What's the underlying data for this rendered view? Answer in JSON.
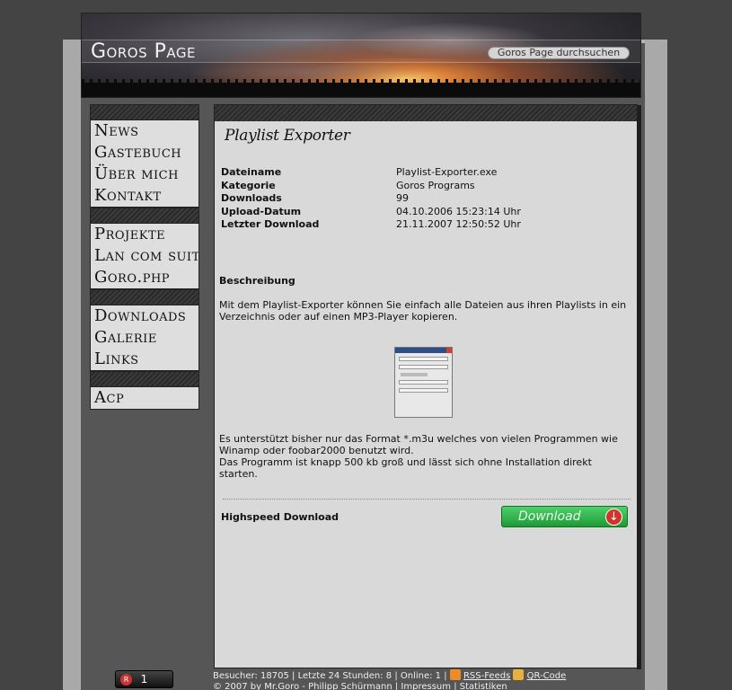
{
  "header": {
    "site_title": "Goros Page",
    "search_label": "Goros Page durchsuchen"
  },
  "sidebar": {
    "groups": [
      [
        "News",
        "Gastebuch",
        "Über mich",
        "Kontakt"
      ],
      [
        "Projekte",
        "Lan com suite",
        "Goro.php"
      ],
      [
        "Downloads",
        "Galerie",
        "Links"
      ],
      [
        "Acp"
      ]
    ]
  },
  "content": {
    "title": "Playlist Exporter",
    "info": [
      {
        "key": "Dateiname",
        "value": "Playlist-Exporter.exe"
      },
      {
        "key": "Kategorie",
        "value": "Goros Programs"
      },
      {
        "key": "Downloads",
        "value": "99"
      },
      {
        "key": "Upload-Datum",
        "value": "04.10.2006 15:23:14 Uhr"
      },
      {
        "key": "Letzter Download",
        "value": "21.11.2007 12:50:52 Uhr"
      }
    ],
    "desc_heading": "Beschreibung",
    "desc_text": "Mit dem Playlist-Exporter können Sie einfach alle Dateien aus ihren Playlists in ein Verzeichnis oder auf einen MP3-Player kopieren.",
    "format_line1": "Es unterstützt bisher nur das Format *.m3u welches von vielen Programmen wie",
    "format_line2": "Winamp oder foobar2000 benutzt wird.",
    "format_line3": "Das Programm ist knapp 500 kb groß und lässt sich ohne Installation direkt starten.",
    "highspeed_label": "Highspeed Download",
    "download_label": "Download"
  },
  "footer": {
    "counter": "1",
    "stats_text": "Besucher: 18705 | Letzte 24 Stunden: 8 | Online: 1 |",
    "rss_label": "RSS-Feeds",
    "qr_label": "QR-Code",
    "copyright": "© 2007 by Mr.Goro - Philipp Schürmann |",
    "impressum": "Impressum",
    "sep": "|",
    "statistiken": "Statistiken"
  }
}
